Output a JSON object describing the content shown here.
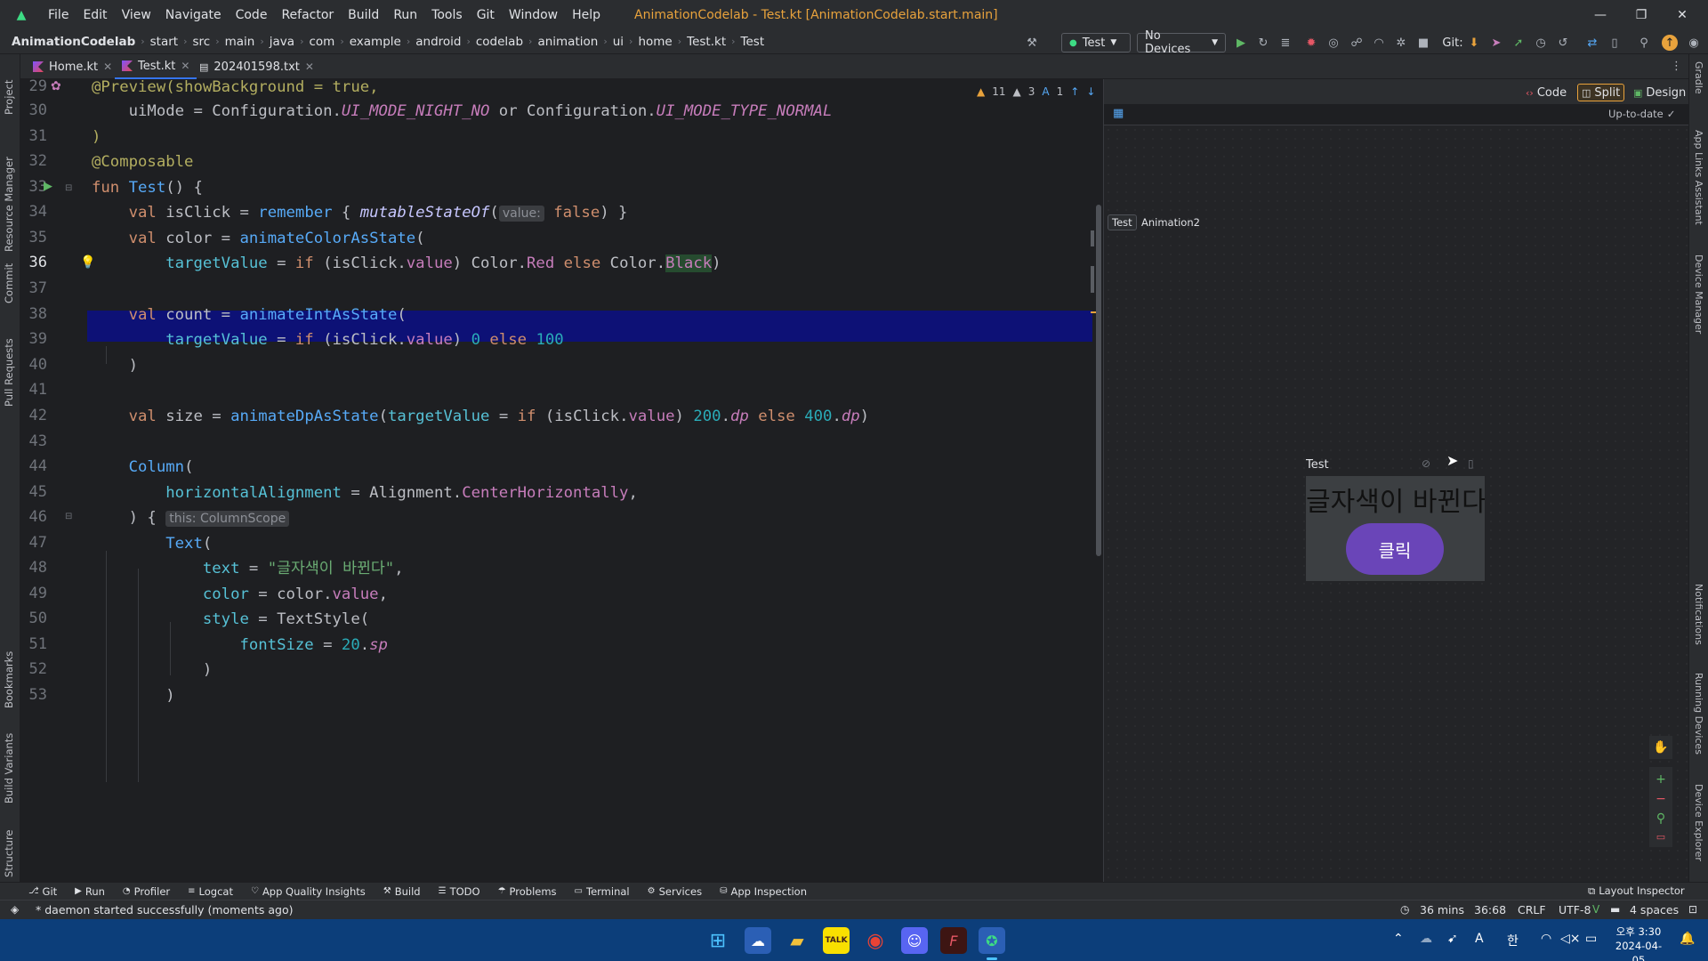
{
  "window": {
    "title": "AnimationCodelab - Test.kt [AnimationCodelab.start.main]",
    "menu": [
      "File",
      "Edit",
      "View",
      "Navigate",
      "Code",
      "Refactor",
      "Build",
      "Run",
      "Tools",
      "Git",
      "Window",
      "Help"
    ]
  },
  "breadcrumb": [
    "AnimationCodelab",
    "start",
    "src",
    "main",
    "java",
    "com",
    "example",
    "android",
    "codelab",
    "animation",
    "ui",
    "home",
    "Test.kt",
    "Test"
  ],
  "toolbar": {
    "run_config": "Test",
    "device": "No Devices",
    "git_label": "Git:"
  },
  "tabs": [
    {
      "label": "Home.kt"
    },
    {
      "label": "Test.kt"
    },
    {
      "label": "202401598.txt"
    }
  ],
  "inspections": {
    "warnings": "11",
    "weak_warnings": "3",
    "typos": "1"
  },
  "code": {
    "line_numbers": [
      "29",
      "30",
      "31",
      "32",
      "33",
      "34",
      "35",
      "36",
      "37",
      "38",
      "39",
      "40",
      "41",
      "42",
      "43",
      "44",
      "45",
      "46",
      "47",
      "48",
      "49",
      "50",
      "51",
      "52",
      "53"
    ],
    "current_line": "36"
  },
  "preview": {
    "modes": [
      "Code",
      "Split",
      "Design"
    ],
    "active_mode": "Split",
    "status": "Up-to-date",
    "groups": [
      "Test",
      "Animation2"
    ],
    "card_title": "Test",
    "card_text": "글자색이 바뀐다",
    "card_button": "클릭"
  },
  "left_tools": [
    "Project",
    "Resource Manager",
    "Commit",
    "Pull Requests",
    "Bookmarks",
    "Build Variants",
    "Structure"
  ],
  "right_tools": [
    "Gradle",
    "App Links Assistant",
    "Device Manager",
    "Notifications",
    "Running Devices",
    "Device Explorer"
  ],
  "bottom_tools": [
    "Git",
    "Run",
    "Profiler",
    "Logcat",
    "App Quality Insights",
    "Build",
    "TODO",
    "Problems",
    "Terminal",
    "Services",
    "App Inspection"
  ],
  "layout_inspector": "Layout Inspector",
  "status": {
    "message": "* daemon started successfully (moments ago)",
    "timer": "36 mins",
    "position": "36:68",
    "line_sep": "CRLF",
    "encoding": "UTF-8",
    "indent": "4 spaces"
  },
  "taskbar": {
    "time": "오후 3:30",
    "date": "2024-04-05",
    "ime": "한",
    "ime_mode": "A"
  }
}
